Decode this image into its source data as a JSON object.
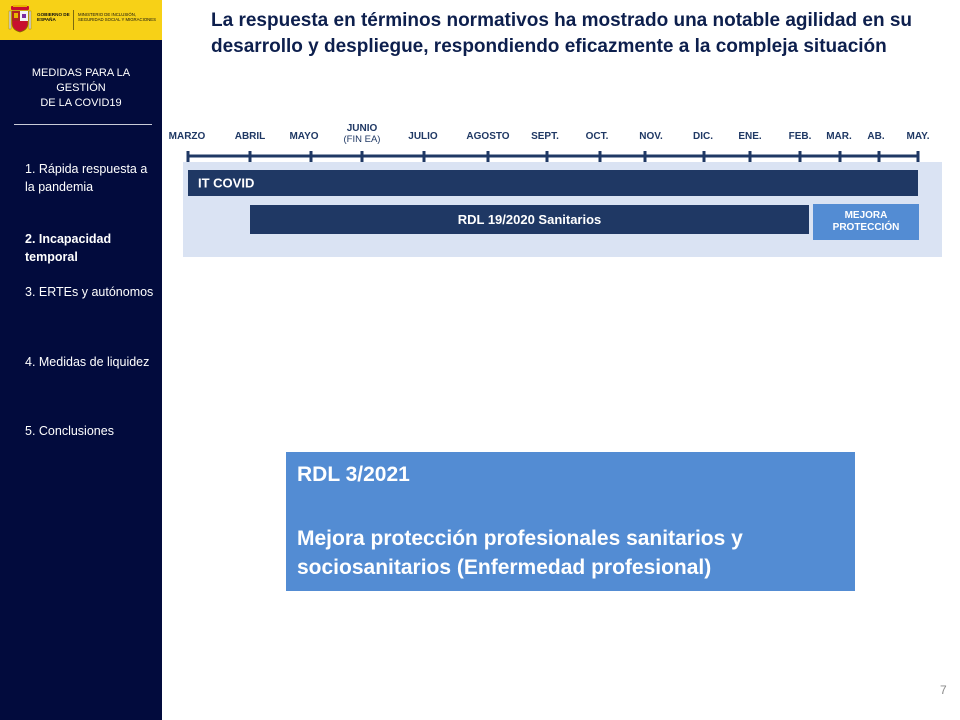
{
  "logo": {
    "government": "GOBIERNO DE ESPAÑA",
    "ministry": "MINISTERIO DE INCLUSIÓN, SEGURIDAD SOCIAL Y MIGRACIONES"
  },
  "sidebar": {
    "title_lines": [
      "MEDIDAS  PARA LA",
      "GESTIÓN",
      "DE LA COVID19"
    ],
    "items": [
      {
        "label": "1. Rápida respuesta a la pandemia",
        "active": false
      },
      {
        "label": "2. Incapacidad temporal",
        "active": true
      },
      {
        "label": "3. ERTEs y autónomos",
        "active": false
      },
      {
        "label": "4. Medidas de liquidez",
        "active": false
      },
      {
        "label": "5. Conclusiones",
        "active": false
      }
    ]
  },
  "headline": "La respuesta en términos normativos ha mostrado una notable agilidad en su desarrollo y despliegue, respondiendo eficazmente a la compleja situación",
  "timeline": {
    "months": [
      {
        "label": "MARZO",
        "sublabel": ""
      },
      {
        "label": "ABRIL",
        "sublabel": ""
      },
      {
        "label": "MAYO",
        "sublabel": ""
      },
      {
        "label": "JUNIO",
        "sublabel": "(FIN EA)"
      },
      {
        "label": "JULIO",
        "sublabel": ""
      },
      {
        "label": "AGOSTO",
        "sublabel": ""
      },
      {
        "label": "SEPT.",
        "sublabel": ""
      },
      {
        "label": "OCT.",
        "sublabel": ""
      },
      {
        "label": "NOV.",
        "sublabel": ""
      },
      {
        "label": "DIC.",
        "sublabel": ""
      },
      {
        "label": "ENE.",
        "sublabel": ""
      },
      {
        "label": "FEB.",
        "sublabel": ""
      },
      {
        "label": "MAR.",
        "sublabel": ""
      },
      {
        "label": "AB.",
        "sublabel": ""
      },
      {
        "label": "MAY.",
        "sublabel": ""
      }
    ],
    "bars": [
      {
        "label": "IT COVID",
        "start_month": "MARZO",
        "end_month": "MAY.",
        "color": "#1f3864"
      },
      {
        "label": "RDL 19/2020 Sanitarios",
        "start_month": "ABRIL",
        "end_month": "FEB.",
        "color": "#1f3864"
      },
      {
        "label": "MEJORA PROTECCIÓN",
        "start_month": "FEB.",
        "end_month": "MAY.",
        "color": "#538cd3"
      }
    ],
    "colors": {
      "axis": "#1f3864",
      "panel": "#dae3f3"
    }
  },
  "rdl_box": {
    "title": "RDL 3/2021",
    "description": "Mejora protección profesionales sanitarios y sociosanitarios (Enfermedad profesional)",
    "color": "#538cd3"
  },
  "page_number": "7"
}
